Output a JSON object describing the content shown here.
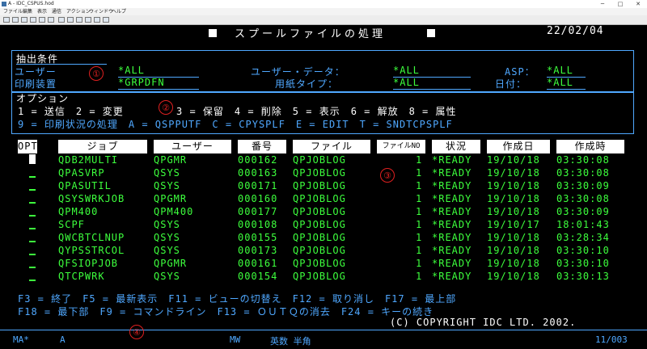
{
  "window": {
    "title": "A - IDC_CSPUS.hod",
    "menu": [
      "ファイル",
      "編集",
      "表示",
      "通信",
      "アクション",
      "ウィンドウ",
      "ヘルプ"
    ]
  },
  "screen": {
    "title": "スプールファイルの処理",
    "date": "22/02/04"
  },
  "filter": {
    "section_label": "抽出条件",
    "user_label": "ユーザー",
    "user_value": "*ALL",
    "userdata_label": "ユーザー・データ：",
    "userdata_value": "*ALL",
    "asp_label": "ASP：",
    "asp_value": "*ALL",
    "printer_label": "印刷装置",
    "printer_value": "*GRPDFN",
    "formtype_label": "用紙タイプ：",
    "formtype_value": "*ALL",
    "date_label": "日付：",
    "date_value": "*ALL"
  },
  "options": {
    "section_label": "オプション",
    "line1_a": "1 = 送信　2 = 変更",
    "line1_b": "3 = 保留　4 = 削除　5 = 表示　6 = 解放　8 = 属性",
    "line2": "9 = 印刷状況の処理　A = QSPPUTF　C = CPYSPLF　E = EDIT　T = SNDTCPSPLF"
  },
  "table": {
    "columns": [
      "OPT",
      "ジョブ",
      "ユーザー",
      "番号",
      "ファイル",
      "ファイルNO",
      "状況",
      "作成日",
      "作成時"
    ],
    "rows": [
      {
        "job": "QDB2MULTI",
        "user": "QPGMR",
        "num": "000162",
        "file": "QPJOBLOG",
        "fno": "1",
        "status": "*READY",
        "date": "19/10/18",
        "time": "03:30:08"
      },
      {
        "job": "QPASVRP",
        "user": "QSYS",
        "num": "000163",
        "file": "QPJOBLOG",
        "fno": "1",
        "status": "*READY",
        "date": "19/10/18",
        "time": "03:30:08"
      },
      {
        "job": "QPASUTIL",
        "user": "QSYS",
        "num": "000171",
        "file": "QPJOBLOG",
        "fno": "1",
        "status": "*READY",
        "date": "19/10/18",
        "time": "03:30:09"
      },
      {
        "job": "QSYSWRKJOB",
        "user": "QPGMR",
        "num": "000160",
        "file": "QPJOBLOG",
        "fno": "1",
        "status": "*READY",
        "date": "19/10/18",
        "time": "03:30:08"
      },
      {
        "job": "QPM400",
        "user": "QPM400",
        "num": "000177",
        "file": "QPJOBLOG",
        "fno": "1",
        "status": "*READY",
        "date": "19/10/18",
        "time": "03:30:09"
      },
      {
        "job": "SCPF",
        "user": "QSYS",
        "num": "000108",
        "file": "QPJOBLOG",
        "fno": "1",
        "status": "*READY",
        "date": "19/10/17",
        "time": "18:01:43"
      },
      {
        "job": "QWCBTCLNUP",
        "user": "QSYS",
        "num": "000155",
        "file": "QPJOBLOG",
        "fno": "1",
        "status": "*READY",
        "date": "19/10/18",
        "time": "03:28:34"
      },
      {
        "job": "QYPSSTRCOL",
        "user": "QSYS",
        "num": "000173",
        "file": "QPJOBLOG",
        "fno": "1",
        "status": "*READY",
        "date": "19/10/18",
        "time": "03:30:10"
      },
      {
        "job": "QFSIOPJOB",
        "user": "QPGMR",
        "num": "000161",
        "file": "QPJOBLOG",
        "fno": "1",
        "status": "*READY",
        "date": "19/10/18",
        "time": "03:30:10"
      },
      {
        "job": "QTCPWRK",
        "user": "QSYS",
        "num": "000154",
        "file": "QPJOBLOG",
        "fno": "1",
        "status": "*READY",
        "date": "19/10/18",
        "time": "03:30:13"
      }
    ]
  },
  "fkeys": {
    "line1": "F3 = 終了　F5 = 最新表示　F11 = ビューの切替え　F12 = 取り消し　F17 = 最上部",
    "line2": "F18 = 最下部　F9 = コマンドライン　F13 = ＯＵＴＱの消去　F24 = キーの続き"
  },
  "copyright": "(C) COPYRIGHT IDC LTD. 2002.",
  "status": {
    "session": "MA*",
    "mode": "A",
    "mw": "MW",
    "input_mode": "英数 半角",
    "cursor": "11/003"
  },
  "markers": [
    "①",
    "②",
    "③",
    "④"
  ],
  "colors": {
    "background": "#000000",
    "field": "#3dff3d",
    "label": "#4fa8ff",
    "text": "#ffffff",
    "marker": "#e02020"
  }
}
